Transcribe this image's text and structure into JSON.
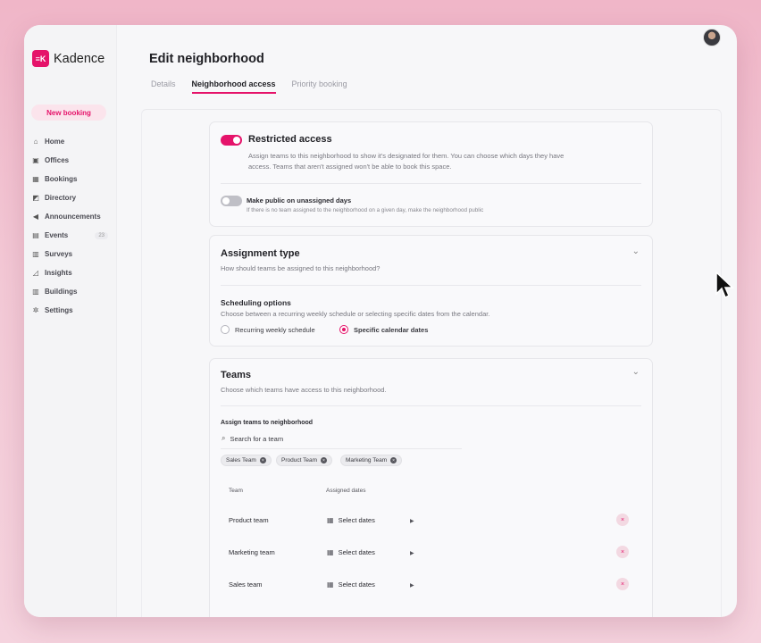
{
  "app": {
    "logo_mark": "≡K",
    "name": "Kadence"
  },
  "sidebar": {
    "new_booking": "New booking",
    "items": [
      {
        "label": "Home",
        "icon": "home-icon",
        "glyph": "⌂"
      },
      {
        "label": "Offices",
        "icon": "office-icon",
        "glyph": "▣"
      },
      {
        "label": "Bookings",
        "icon": "calendar-icon",
        "glyph": "▦"
      },
      {
        "label": "Directory",
        "icon": "directory-icon",
        "glyph": "◩"
      },
      {
        "label": "Announcements",
        "icon": "megaphone-icon",
        "glyph": "◀"
      },
      {
        "label": "Events",
        "icon": "events-icon",
        "glyph": "▤",
        "badge": "23"
      },
      {
        "label": "Surveys",
        "icon": "survey-icon",
        "glyph": "▥"
      },
      {
        "label": "Insights",
        "icon": "insights-icon",
        "glyph": "◿"
      },
      {
        "label": "Buildings",
        "icon": "building-icon",
        "glyph": "▥"
      },
      {
        "label": "Settings",
        "icon": "gear-icon",
        "glyph": "✲"
      }
    ]
  },
  "header": {
    "title": "Edit neighborhood",
    "tabs": [
      {
        "label": "Details",
        "active": false
      },
      {
        "label": "Neighborhood access",
        "active": true
      },
      {
        "label": "Priority booking",
        "active": false
      }
    ]
  },
  "restricted": {
    "title": "Restricted access",
    "enabled": true,
    "desc_line1": "Assign teams to this neighborhood to show it's designated for them. You can choose which days they have",
    "desc_line2": "access. Teams that aren't assigned won't be able to book this space.",
    "public_title": "Make public on unassigned days",
    "public_enabled": false,
    "public_desc": "If there is no team assigned to the neighborhood on a given day, make the neighborhood public"
  },
  "assignment": {
    "title": "Assignment type",
    "desc": "How should teams be assigned to this neighborhood?",
    "scheduling_title": "Scheduling options",
    "scheduling_desc": "Choose between a recurring weekly schedule or selecting specific dates from the calendar.",
    "option_recurring": "Recurring weekly schedule",
    "option_specific": "Specific calendar dates",
    "selected": "Specific calendar dates"
  },
  "teams": {
    "title": "Teams",
    "desc": "Choose which teams have access to this neighborhood.",
    "assign_label": "Assign teams to neighborhood",
    "search_placeholder": "Search for a team",
    "chips": [
      "Sales Team",
      "Product Team",
      "Marketing Team"
    ],
    "col_team": "Team",
    "col_dates": "Assigned dates",
    "rows": [
      {
        "team": "Product team",
        "dates": "Select dates"
      },
      {
        "team": "Marketing team",
        "dates": "Select dates"
      },
      {
        "team": "Sales team",
        "dates": "Select dates"
      }
    ]
  },
  "colors": {
    "accent": "#e5136a",
    "background": "#f7f7f9"
  }
}
